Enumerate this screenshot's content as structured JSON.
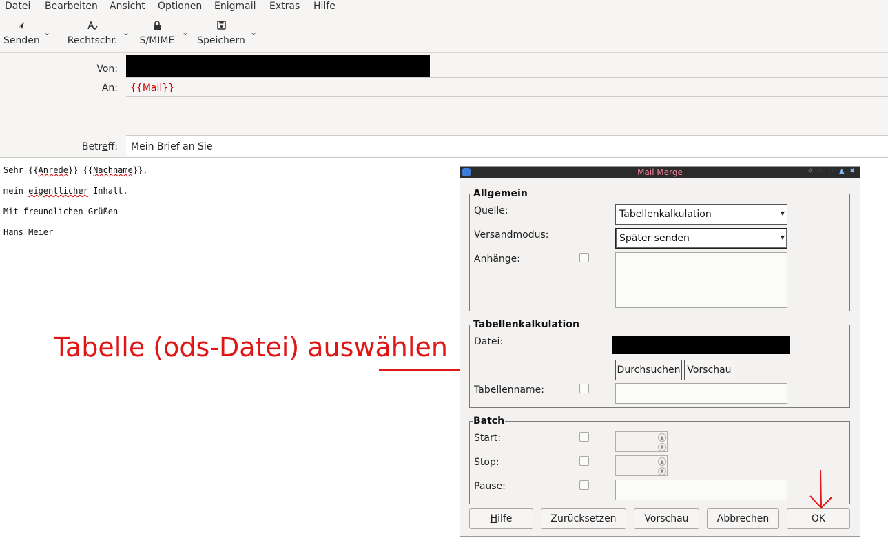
{
  "menu": [
    {
      "first": "D",
      "rest": "atei"
    },
    {
      "first": "B",
      "rest": "earbeiten"
    },
    {
      "first": "A",
      "rest": "nsicht"
    },
    {
      "first": "O",
      "rest": "ptionen"
    },
    {
      "pre": "E",
      "first": "n",
      "rest": "igmail"
    },
    {
      "pre": "E",
      "first": "x",
      "rest": "tras"
    },
    {
      "first": "H",
      "rest": "ilfe"
    }
  ],
  "toolbar": {
    "send": "Senden",
    "spelling": "Rechtschr.",
    "smime": "S/MIME",
    "save": "Speichern"
  },
  "header": {
    "from_label": "Von:",
    "to_label": "An:",
    "to_value": "{{Mail}}",
    "subject_label_a": "Betr",
    "subject_label_b": "e",
    "subject_label_c": "ff:",
    "subject_value": "Mein Brief an Sie"
  },
  "body": {
    "line1_a": "Sehr {{",
    "line1_b": "Anrede",
    "line1_c": "}} {{",
    "line1_d": "Nachname",
    "line1_e": "}},",
    "line2_a": "mein ",
    "line2_b": "eigentlicher",
    "line2_c": " Inhalt.",
    "line3": "Mit freundlichen Grüßen",
    "line4": "Hans Meier"
  },
  "annotation": "Tabelle (ods-Datei) auswählen",
  "dialog": {
    "title": "Mail Merge",
    "general": {
      "title": "Allgemein",
      "source_label": "Quelle:",
      "source_value": "Tabellenkalkulation",
      "mode_label": "Versandmodus:",
      "mode_value": "Später senden",
      "attachments_label": "Anhänge:"
    },
    "spreadsheet": {
      "title": "Tabellenkalkulation",
      "file_label": "Datei:",
      "browse": "Durchsuchen",
      "preview": "Vorschau",
      "sheet_label": "Tabellenname:"
    },
    "batch": {
      "title": "Batch",
      "start_label": "Start:",
      "stop_label": "Stop:",
      "pause_label": "Pause:"
    },
    "buttons": {
      "help_first": "H",
      "help_rest": "ilfe",
      "reset": "Zurücksetzen",
      "preview": "Vorschau",
      "cancel": "Abbrechen",
      "ok": "OK"
    }
  }
}
